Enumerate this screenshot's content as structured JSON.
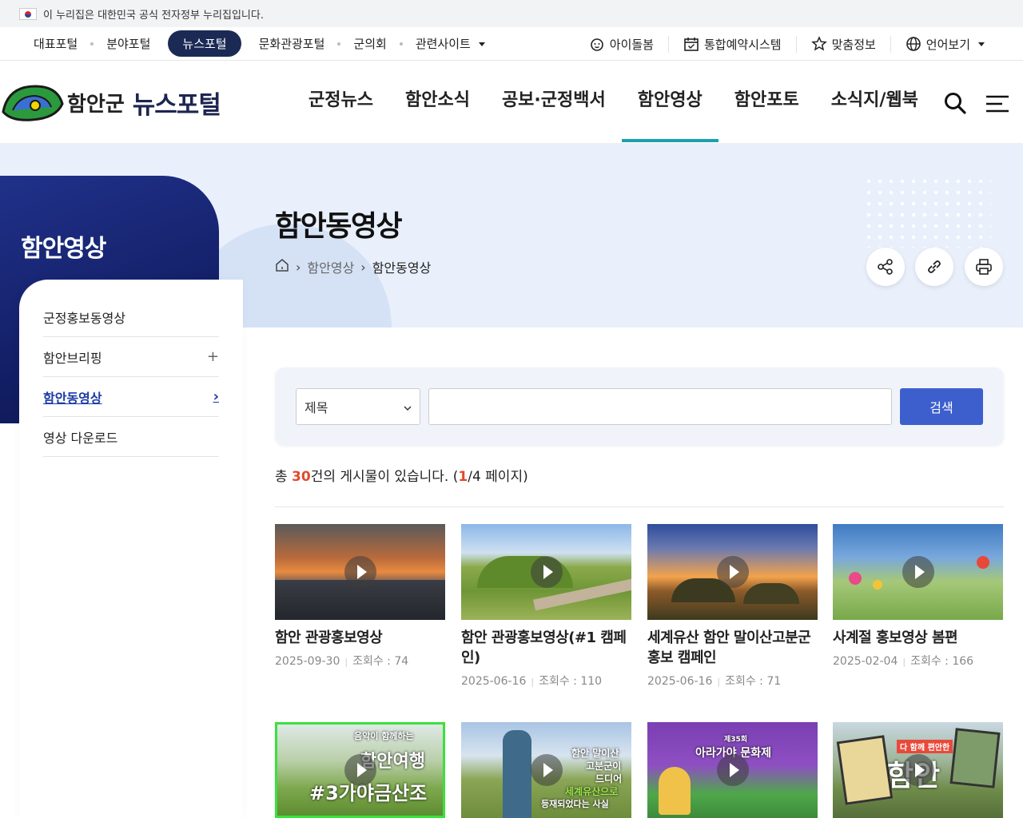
{
  "gov_bar": {
    "text": "이 누리집은 대한민국 공식 전자정부 누리집입니다."
  },
  "portal": {
    "left": [
      "대표포털",
      "분야포털",
      "뉴스포털",
      "문화관광포털",
      "군의회",
      "관련사이트"
    ],
    "right": [
      "아이돌봄",
      "통합예약시스템",
      "맞춤정보",
      "언어보기"
    ]
  },
  "logo": {
    "sub": "함안군",
    "main": "뉴스포털"
  },
  "gnb": [
    "군정뉴스",
    "함안소식",
    "공보·군정백서",
    "함안영상",
    "함안포토",
    "소식지/웹북"
  ],
  "sidebar": {
    "title": "함안영상",
    "items": [
      {
        "label": "군정홍보동영상",
        "icon": ""
      },
      {
        "label": "함안브리핑",
        "icon": "+"
      },
      {
        "label": "함안동영상",
        "icon": "›"
      },
      {
        "label": "영상 다운로드",
        "icon": ""
      }
    ]
  },
  "page": {
    "title": "함안동영상",
    "breadcrumb": [
      "함안영상",
      "함안동영상"
    ]
  },
  "search": {
    "select": "제목",
    "button": "검색",
    "keyword": ""
  },
  "count": {
    "prefix": "총 ",
    "total": "30",
    "mid": "건의 게시물이 있습니다. (",
    "page": "1",
    "suffix": "/4 페이지)"
  },
  "videos": [
    {
      "title": "함안 관광홍보영상",
      "date": "2025-09-30",
      "views": "조회수 : 74",
      "theme": "sunset"
    },
    {
      "title": "함안 관광홍보영상(#1 캠페인)",
      "date": "2025-06-16",
      "views": "조회수 : 110",
      "theme": "tombs"
    },
    {
      "title": "세계유산 함안 말이산고분군 홍보 캠페인",
      "date": "2025-06-16",
      "views": "조회수 : 71",
      "theme": "dusk"
    },
    {
      "title": "사계절 홍보영상 봄편",
      "date": "2025-02-04",
      "views": "조회수 : 166",
      "theme": "pinwheel"
    },
    {
      "title": "",
      "date": "",
      "views": "",
      "theme": "yoga",
      "overlay": [
        "음악이 함께하는",
        "함안여행",
        "#3가야금산조"
      ]
    },
    {
      "title": "",
      "date": "",
      "views": "",
      "theme": "traveler",
      "overlay": [
        "함안 말이산",
        "고분군이",
        "드디어",
        "세계유산으로",
        "등재되었다는 사실"
      ]
    },
    {
      "title": "",
      "date": "",
      "views": "",
      "theme": "festival",
      "overlay": [
        "제35회",
        "아라가야 문화제"
      ]
    },
    {
      "title": "",
      "date": "",
      "views": "",
      "theme": "poster",
      "overlay": [
        "다 함께 편안한",
        "함안"
      ]
    }
  ]
}
